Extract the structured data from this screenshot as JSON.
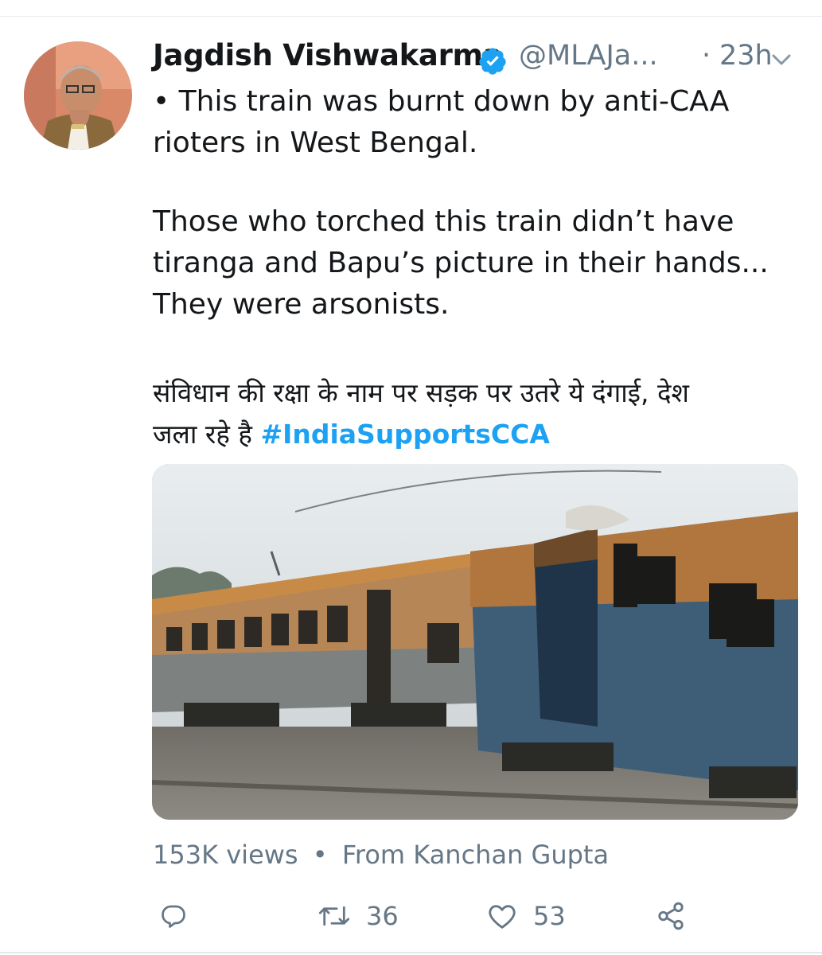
{
  "tweet": {
    "author": {
      "name": "Jagdish Vishwakarma",
      "handle": "@MLAJa...",
      "verified": true
    },
    "separator": "·",
    "time": "23h",
    "text": {
      "p1_line1": "• This train was burnt down by anti-CAA",
      "p1_line2": "rioters in West Bengal.",
      "p2_line1": "Those who torched this train didn’t have",
      "p2_line2": "tiranga and Bapu’s picture in their hands...",
      "p2_line3": "They were arsonists.",
      "p3_line1": "संविधान की रक्षा के नाम पर सड़क पर उतरे ये दंगाई, देश",
      "p3_line2": "जला रहे है",
      "hashtag": "#IndiaSupportsCCA"
    },
    "media": {
      "type": "video-still",
      "subject": "burnt train coaches"
    },
    "meta": {
      "views": "153K views",
      "bullet": "•",
      "from": "From Kanchan Gupta"
    },
    "actions": {
      "reply_icon": "reply-icon",
      "retweet_icon": "retweet-icon",
      "retweet_count": "36",
      "like_icon": "heart-icon",
      "like_count": "53",
      "share_icon": "share-icon"
    }
  },
  "colors": {
    "text": "#14171a",
    "secondary": "#657786",
    "link": "#1da1f2",
    "verified": "#1da1f2",
    "divider": "#e6ecf0"
  }
}
